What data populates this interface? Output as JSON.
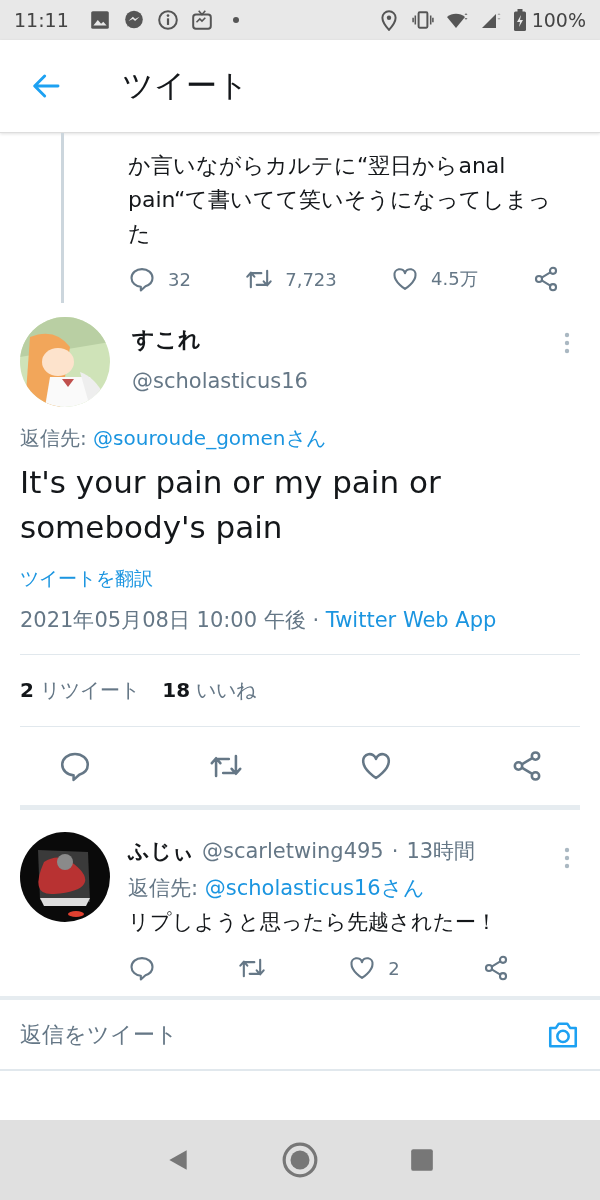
{
  "status_bar": {
    "time": "11:11",
    "battery": "100%"
  },
  "header": {
    "title": "ツイート"
  },
  "previous_tweet": {
    "text": "か言いながらカルテに“翌日からanal pain“て書いてて笑いそうになってしまった",
    "replies": "32",
    "retweets": "7,723",
    "likes": "4.5万"
  },
  "main_tweet": {
    "name": "すこれ",
    "handle": "@scholasticus16",
    "reply_label": "返信先:",
    "reply_to": "@souroude_gomenさん",
    "text": "It's your pain or my pain or somebody's pain",
    "translate": "ツイートを翻訳",
    "timestamp": "2021年05月08日 10:00 午後",
    "separator": "·",
    "source": "Twitter Web App",
    "retweets_count": "2",
    "retweets_label": "リツイート",
    "likes_count": "18",
    "likes_label": "いいね"
  },
  "replies": [
    {
      "name": "ふじぃ",
      "handle": "@scarletwing495",
      "separator": "·",
      "time": "13時間",
      "reply_label": "返信先:",
      "reply_to": "@scholasticus16さん",
      "text": "リプしようと思ったら先越されたー！",
      "likes": "2"
    }
  ],
  "composer": {
    "placeholder": "返信をツイート"
  }
}
